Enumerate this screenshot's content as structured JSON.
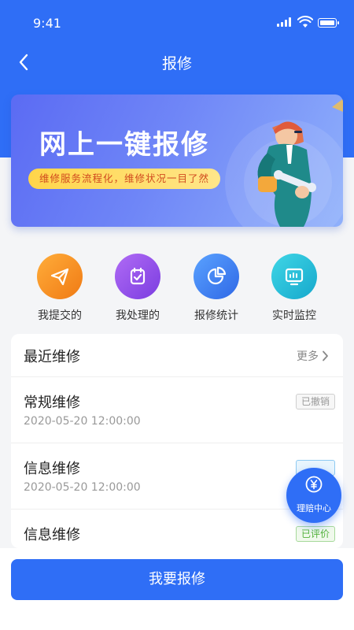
{
  "status_bar": {
    "time": "9:41"
  },
  "nav": {
    "title": "报修",
    "back_icon": "chevron-left-icon"
  },
  "banner": {
    "title": "网上一键报修",
    "subtitle": "维修服务流程化，维修状况一目了然"
  },
  "quick_actions": [
    {
      "label": "我提交的",
      "icon": "paper-plane-icon",
      "color": "#f28a1c"
    },
    {
      "label": "我处理的",
      "icon": "clipboard-check-icon",
      "color": "#8d4ce6"
    },
    {
      "label": "报修统计",
      "icon": "pie-chart-icon",
      "color": "#3a7cf0"
    },
    {
      "label": "实时监控",
      "icon": "monitor-icon",
      "color": "#1fb6d2"
    }
  ],
  "recent": {
    "title": "最近维修",
    "more_label": "更多",
    "items": [
      {
        "name": "常规维修",
        "time": "2020-05-20 12:00:00",
        "status": "已撤销",
        "status_color": "#999999"
      },
      {
        "name": "信息维修",
        "time": "2020-05-20 12:00:00",
        "status": "",
        "status_color": "#3aa0e8"
      },
      {
        "name": "信息维修",
        "time": "",
        "status": "已评价",
        "status_color": "#52b23a"
      }
    ]
  },
  "fab": {
    "label": "理赔中心",
    "icon": "yen-icon"
  },
  "footer": {
    "submit_label": "我要报修"
  },
  "colors": {
    "primary": "#2f6ef6",
    "background": "#f4f5f7"
  }
}
